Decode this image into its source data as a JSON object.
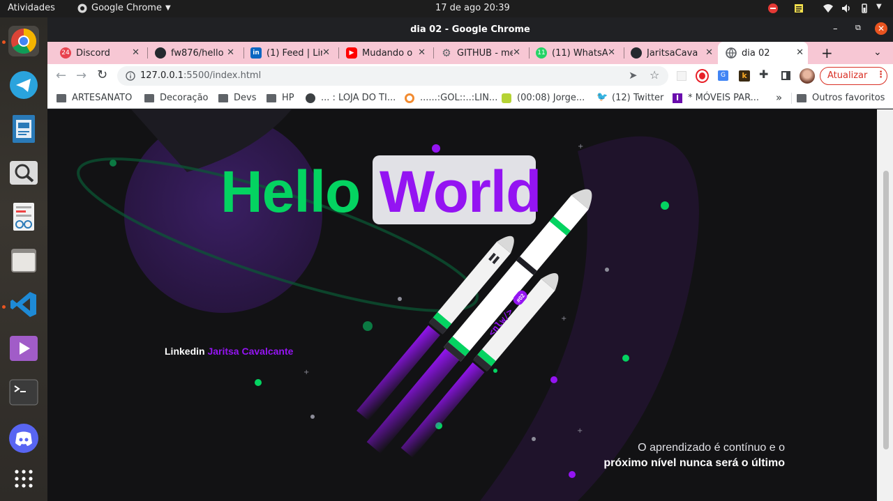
{
  "system_bar": {
    "activities": "Atividades",
    "app_menu": "Google Chrome",
    "clock": "17 de ago  20:39"
  },
  "window": {
    "title": "dia 02 - Google Chrome"
  },
  "tabs": [
    {
      "title": "Discord",
      "favicon": "discord-icon",
      "badge": "24",
      "color": "#e8434f"
    },
    {
      "title": "fw876/hello",
      "favicon": "github-icon",
      "color": "#24292e"
    },
    {
      "title": "(1) Feed | Lin",
      "favicon": "linkedin-icon",
      "color": "#0a66c2"
    },
    {
      "title": "Mudando o",
      "favicon": "youtube-icon",
      "color": "#ff0000"
    },
    {
      "title": "GITHUB - me",
      "favicon": "gear-icon",
      "color": "#5f6368"
    },
    {
      "title": "(11) WhatsA",
      "favicon": "whatsapp-icon",
      "badge": "11",
      "color": "#25d366"
    },
    {
      "title": "JaritsaCava",
      "favicon": "github-icon",
      "color": "#24292e"
    },
    {
      "title": "dia 02",
      "favicon": "globe-icon",
      "color": "#5f6368",
      "active": true
    }
  ],
  "toolbar": {
    "url_host": "127.0.0.1",
    "url_rest": ":5500/index.html",
    "update_button": "Atualizar"
  },
  "bookmarks": [
    {
      "label": "ARTESANATO",
      "icon": "folder-icon"
    },
    {
      "label": "Decoração",
      "icon": "folder-icon"
    },
    {
      "label": "Devs",
      "icon": "folder-icon"
    },
    {
      "label": "HP",
      "icon": "folder-icon"
    },
    {
      "label": "... : LOJA DO TI...",
      "icon": "globe-icon"
    },
    {
      "label": "......:GOL::..:LIN...",
      "icon": "ring-icon"
    },
    {
      "label": "(00:08) Jorge...",
      "icon": "flower-icon"
    },
    {
      "label": "(12) Twitter",
      "icon": "twitter-icon"
    },
    {
      "label": "* MÓVEIS PAR...",
      "icon": "letter-i-icon"
    }
  ],
  "bookmarks_more": "»",
  "bookmarks_other": "Outros favoritos",
  "page": {
    "hello": "Hello",
    "world": "World",
    "rocket_badge": "#02",
    "rocket_logo": "<nlw/>",
    "linkedin_label": "Linkedin",
    "linkedin_name": "Jaritsa Cavalcante",
    "quote_line1": "O aprendizado é contínuo e o",
    "quote_line2": "próximo nível nunca será o último"
  },
  "colors": {
    "green": "#04d361",
    "purple": "#9414f2",
    "page_bg": "#121214",
    "tabstrip": "#f7c7d4"
  }
}
